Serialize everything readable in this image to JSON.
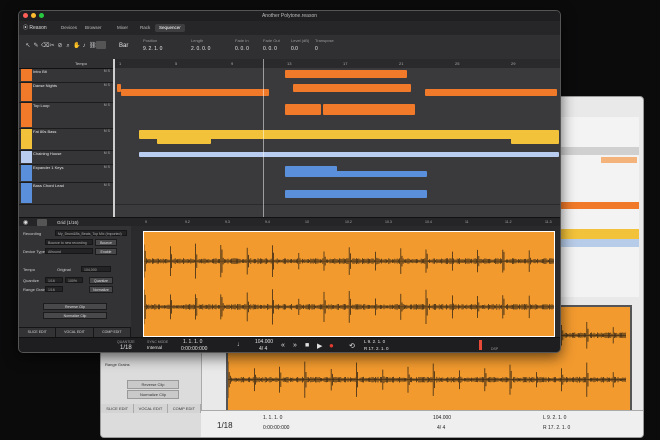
{
  "app": {
    "window_title": "Another Polytone.reason",
    "brand": "Reason",
    "tabs": [
      {
        "label": "Devices"
      },
      {
        "label": "Browser"
      },
      {
        "label": "Mixer"
      },
      {
        "label": "Rack"
      },
      {
        "label": "Sequencer"
      }
    ]
  },
  "toolbar": {
    "snap_label": "Bar",
    "fields": [
      {
        "label": "Position",
        "value": "9. 2. 1. 0"
      },
      {
        "label": "Length",
        "value": "2. 0. 0. 0"
      },
      {
        "label": "Fade In",
        "value": "0. 0. 0"
      },
      {
        "label": "Fade Out",
        "value": "0. 0. 0"
      },
      {
        "label": "Level (dB)",
        "value": "0.0"
      },
      {
        "label": "Transpose",
        "value": "0"
      }
    ]
  },
  "tracks": {
    "tempo_label": "Tempo",
    "items": [
      {
        "name": "Intro Bit",
        "color": "#f07a2a"
      },
      {
        "name": "Danse Nights",
        "color": "#f07a2a"
      },
      {
        "name": "Top Loop",
        "color": "#f07a2a"
      },
      {
        "name": "Fat 80s Bass",
        "color": "#f2c23a"
      },
      {
        "name": "Chaining House",
        "color": "#b9cdf0"
      },
      {
        "name": "Expander 1 Keys",
        "color": "#5a8fdb"
      },
      {
        "name": "Bass Chord Lead",
        "color": "#5a8fdb"
      }
    ]
  },
  "ruler": {
    "marks": [
      "1",
      "5",
      "9",
      "13",
      "17",
      "21",
      "25",
      "29"
    ]
  },
  "editor": {
    "snap_label": "Grid (1/16)",
    "ruler_marks": [
      "9",
      "9.2",
      "9.3",
      "9.4",
      "10",
      "10.2",
      "10.3",
      "10.4",
      "11",
      "11.2",
      "11.3"
    ]
  },
  "inspector": {
    "section_recording": "Recording",
    "recording_file": "My_Drum&Bs_Beats_Top Mix (Imported)",
    "bounce_label": "Bounce to new recording",
    "bounce_btn": "Bounce",
    "device_type_label": "Device Type",
    "device_type_value": "Allround",
    "enable_btn": "Enable",
    "section_tempo": "Tempo",
    "original_label": "Original",
    "original_value": "104,000",
    "quantize_label": "Quantize",
    "quantize_value": "1/16",
    "quantize_pct": "100%",
    "quantize_btn": "Quantize",
    "range_label": "Range Grains",
    "range_value": "1/16",
    "range_btn": "Normalize",
    "reverse_btn": "Reverse Clip",
    "normalize_btn": "Normalize Clip",
    "tabs": [
      "SLICE EDIT",
      "VOCAL EDIT",
      "COMP EDIT"
    ]
  },
  "transport": {
    "quantize_label": "QUANTIZE",
    "quantize_value": "1/18",
    "sync_label": "SYNC MODE",
    "sync_value": "Internal",
    "position": "1. 1. 1. 0",
    "time": "0:00:00:000",
    "tempo": "104.000",
    "signature": "4/ 4",
    "loop_left": "L 9. 2. 1. 0",
    "loop_right": "R 17. 2. 1. 0",
    "dsp_label": "DSP"
  },
  "bg_window": {
    "reverse_btn": "Reverse Clip",
    "normalize_btn": "Normalize Clip",
    "range_label": "Range Grains",
    "tabs": [
      "SLICE EDIT",
      "VOCAL EDIT",
      "COMP EDIT"
    ],
    "quantize_value": "1/18",
    "position": "1. 1. 1. 0",
    "time": "0:00:00:000",
    "tempo": "104.000",
    "signature": "4/ 4",
    "loop_left": "L 9. 2. 1. 0",
    "loop_right": "R 17. 2. 1. 0"
  },
  "colors": {
    "orange": "#f07a2a",
    "yellow": "#f2c23a",
    "blue": "#5a8fdb",
    "wave_bg": "#f29a2e",
    "wave_fg": "#3a2a16"
  }
}
